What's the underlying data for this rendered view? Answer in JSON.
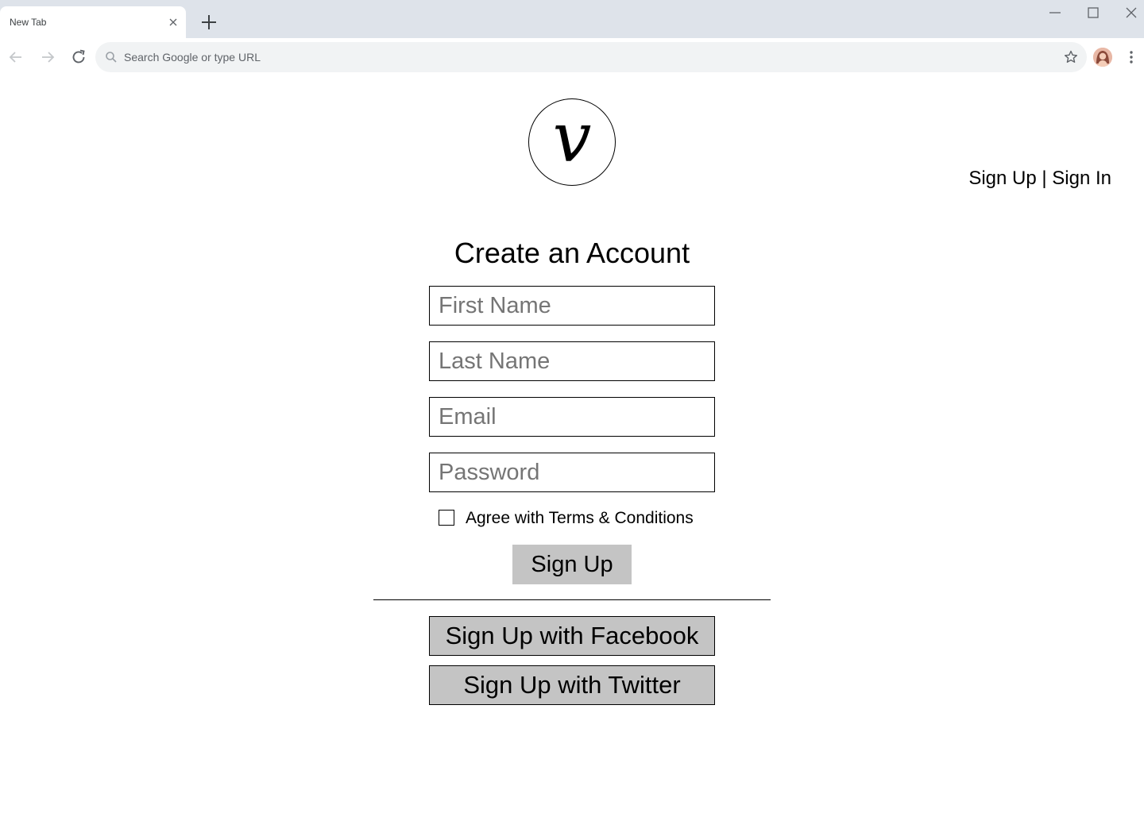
{
  "browser": {
    "tab_title": "New Tab",
    "omnibox_placeholder": "Search Google or type URL"
  },
  "header": {
    "logo_letter": "V",
    "signup_link": "Sign Up",
    "separator": "|",
    "signin_link": "Sign In"
  },
  "form": {
    "title": "Create an Account",
    "first_name_placeholder": "First Name",
    "last_name_placeholder": "Last Name",
    "email_placeholder": "Email",
    "password_placeholder": "Password",
    "terms_label": "Agree with Terms & Conditions",
    "terms_checked": false,
    "signup_button": "Sign Up",
    "facebook_button": "Sign Up with Facebook",
    "twitter_button": "Sign Up with Twitter"
  },
  "colors": {
    "button_gray": "#c4c4c4",
    "tabstrip": "#dee3ea",
    "omnibox": "#f1f3f4"
  }
}
